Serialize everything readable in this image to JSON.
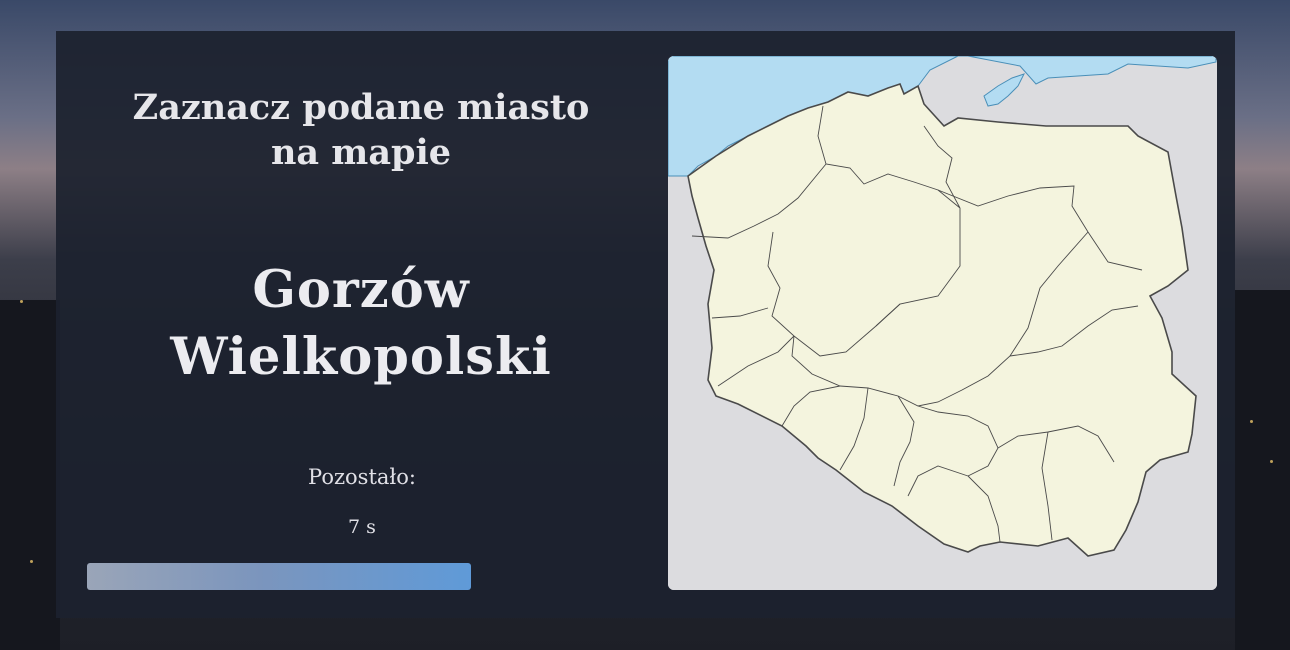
{
  "quiz": {
    "instruction": "Zaznacz podane miasto na mapie",
    "city": "Gorzów Wielkopolski",
    "remaining_label": "Pozostało:",
    "remaining_time": "7 s",
    "progress_fraction": 1.0
  },
  "map": {
    "icon": "poland-voivodeships-map",
    "colors": {
      "sea": "#b3dcf2",
      "land_poland": "#f4f4de",
      "land_neighbors": "#dcdcdf",
      "border": "#4a4a4a"
    }
  }
}
